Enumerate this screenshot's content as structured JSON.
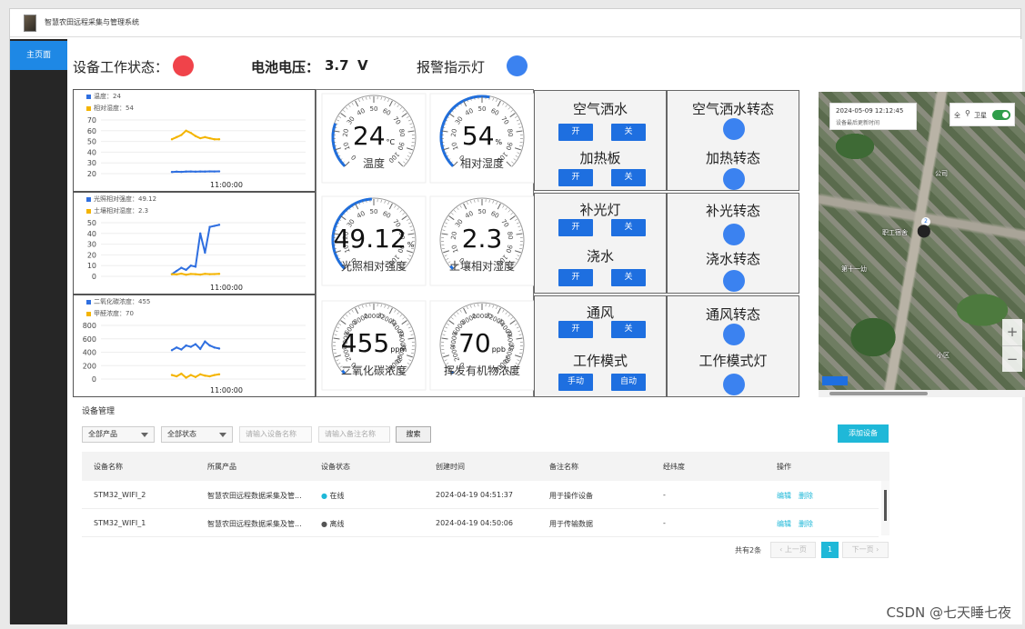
{
  "app": {
    "title": "智慧农田远程采集与管理系统"
  },
  "sidebar": {
    "items": [
      {
        "label": "主页面"
      }
    ]
  },
  "status": {
    "work_label": "设备工作状态：",
    "work_color": "#f0434a",
    "battery_label": "电池电压：",
    "battery_value": "3.7",
    "battery_unit": "V",
    "alarm_label": "报警指示灯",
    "alarm_color": "#3b82f0"
  },
  "chart_data": [
    {
      "type": "line",
      "series": [
        {
          "name": "温度：24",
          "color": "#2f6fe0",
          "values": [
            21.5,
            21.8,
            21.6,
            21.9,
            22.0,
            21.8,
            22.0,
            21.9,
            22.1,
            22.0,
            22.1
          ]
        },
        {
          "name": "相对湿度：54",
          "color": "#f4b400",
          "values": [
            52,
            54,
            56,
            60,
            58,
            55,
            53,
            54,
            53,
            52,
            52
          ]
        }
      ],
      "yticks": [
        "70",
        "60",
        "50",
        "40",
        "30",
        "20"
      ],
      "ylim": [
        20,
        70
      ],
      "xlabel_tick": "11:00:00"
    },
    {
      "type": "line",
      "series": [
        {
          "name": "光照相对强度：49.12",
          "color": "#2f6fe0",
          "values": [
            2,
            5,
            8,
            6,
            10,
            9,
            40,
            22,
            46,
            47,
            48
          ]
        },
        {
          "name": "土壤相对湿度：2.3",
          "color": "#f4b400",
          "values": [
            2,
            1.8,
            2.5,
            1.5,
            2.2,
            2.0,
            1.6,
            2.3,
            2.0,
            2.1,
            2.3
          ]
        }
      ],
      "yticks": [
        "50",
        "40",
        "30",
        "20",
        "10",
        "0"
      ],
      "ylim": [
        0,
        50
      ],
      "xlabel_tick": "11:00:00"
    },
    {
      "type": "line",
      "series": [
        {
          "name": "二氧化碳浓度：455",
          "color": "#2f6fe0",
          "values": [
            430,
            470,
            440,
            500,
            480,
            520,
            450,
            560,
            500,
            470,
            455
          ]
        },
        {
          "name": "甲醛浓度：70",
          "color": "#f4b400",
          "values": [
            60,
            40,
            80,
            20,
            60,
            30,
            70,
            50,
            40,
            60,
            70
          ]
        }
      ],
      "yticks": [
        "800",
        "600",
        "400",
        "200",
        "0"
      ],
      "ylim": [
        0,
        800
      ],
      "xlabel_tick": "11:00:00"
    }
  ],
  "gauges": [
    {
      "value": "24",
      "unit": "°C",
      "label": "温度",
      "fraction": 0.24,
      "ticks": [
        "0",
        "10",
        "20",
        "30",
        "40",
        "50",
        "60",
        "70",
        "80",
        "90",
        "100"
      ]
    },
    {
      "value": "54",
      "unit": "%",
      "label": "相对湿度",
      "fraction": 0.54,
      "ticks": [
        "0",
        "10",
        "20",
        "30",
        "40",
        "50",
        "60",
        "70",
        "80",
        "90",
        "100"
      ]
    },
    {
      "value": "49.12",
      "unit": "%",
      "label": "光照相对强度",
      "fraction": 0.49,
      "ticks": [
        "0",
        "10",
        "20",
        "30",
        "40",
        "50",
        "60",
        "70",
        "80",
        "90",
        "100"
      ]
    },
    {
      "value": "2.3",
      "unit": "",
      "label": "土壤相对湿度",
      "fraction": 0.02,
      "ticks": [
        "0",
        "10",
        "20",
        "30",
        "40",
        "50",
        "60",
        "70",
        "80",
        "90",
        "100"
      ]
    },
    {
      "value": "455",
      "unit": "ppm",
      "label": "二氧化碳浓度",
      "fraction": 0.02,
      "ticks": [
        "0",
        "2000",
        "4000",
        "6000",
        "8000",
        "10000",
        "12000",
        "14000",
        "16000",
        "18000",
        "20000"
      ]
    },
    {
      "value": "70",
      "unit": "ppb",
      "label": "挥发有机物浓度",
      "fraction": 0.01,
      "ticks": [
        "0",
        "2000",
        "4000",
        "6000",
        "8000",
        "10000",
        "12000",
        "14000",
        "16000",
        "18000",
        "20000"
      ]
    }
  ],
  "controls": [
    {
      "title": "空气洒水",
      "on": "开",
      "off": "关"
    },
    {
      "title": "加热板",
      "on": "开",
      "off": "关"
    },
    {
      "title": "补光灯",
      "on": "开",
      "off": "关"
    },
    {
      "title": "浇水",
      "on": "开",
      "off": "关"
    },
    {
      "title": "通风",
      "on": "开",
      "off": "关"
    },
    {
      "title": "工作模式",
      "on": "手动",
      "off": "自动"
    }
  ],
  "indicators": [
    {
      "title": "空气洒水转态"
    },
    {
      "title": "加热转态"
    },
    {
      "title": "补光转态"
    },
    {
      "title": "浇水转态"
    },
    {
      "title": "通风转态"
    },
    {
      "title": "工作模式灯"
    }
  ],
  "map": {
    "timestamp": "2024-05-09 12:12:45",
    "update_label": "设备最后更新时间",
    "fullscreen_label": "全",
    "satellite_label": "卫星",
    "marker_count": "2",
    "zoom_in": "+",
    "zoom_out": "−",
    "place_labels": [
      "职工宿舍",
      "公司",
      "第十一幼",
      "小区"
    ]
  },
  "device_management": {
    "title": "设备管理",
    "filter_product": "全部产品",
    "filter_status": "全部状态",
    "name_placeholder": "请输入设备名称",
    "remark_placeholder": "请输入备注名称",
    "search_label": "搜索",
    "add_label": "添加设备",
    "columns": [
      "设备名称",
      "所属产品",
      "设备状态",
      "创建时间",
      "备注名称",
      "经纬度",
      "操作"
    ],
    "rows": [
      {
        "name": "STM32_WIFI_2",
        "product": "智慧农田远程数据采集及管...",
        "status": "在线",
        "status_color": "#1fb8d8",
        "created": "2024-04-19 04:51:37",
        "remark": "用于操作设备",
        "coords": "-",
        "edit": "编辑",
        "delete": "删除"
      },
      {
        "name": "STM32_WIFI_1",
        "product": "智慧农田远程数据采集及管...",
        "status": "离线",
        "status_color": "#555555",
        "created": "2024-04-19 04:50:06",
        "remark": "用于传输数据",
        "coords": "-",
        "edit": "编辑",
        "delete": "删除"
      }
    ],
    "pagination": {
      "total": "共有2条",
      "prev": "上一页",
      "page": "1",
      "next": "下一页"
    }
  },
  "watermark": "CSDN @七天睡七夜"
}
